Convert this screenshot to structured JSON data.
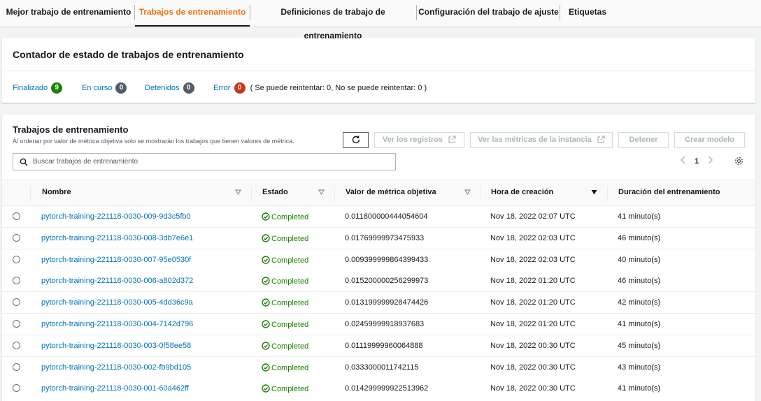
{
  "tabs": [
    {
      "label": "Mejor trabajo de entrenamiento"
    },
    {
      "label": "Trabajos de entrenamiento"
    },
    {
      "label": "Definiciones de trabajo de entrenamiento"
    },
    {
      "label": "Configuración del trabajo de ajuste"
    },
    {
      "label": "Etiquetas"
    }
  ],
  "counter": {
    "title": "Contador de estado de trabajos de entrenamiento",
    "completed_label": "Finalizado",
    "completed_count": "9",
    "inprogress_label": "En curso",
    "inprogress_count": "0",
    "stopped_label": "Detenidos",
    "stopped_count": "0",
    "error_label": "Error",
    "error_count": "0",
    "error_note": "( Se puede reintentar: 0, No se puede reintentar: 0 )"
  },
  "jobs": {
    "title": "Trabajos de entrenamiento",
    "subtitle": "Al ordenar por valor de métrica objetiva solo se mostrarán los trabajos que tienen valores de métrica.",
    "btn_logs": "Ver los registros",
    "btn_metrics": "Ver las métricas de la instancia",
    "btn_stop": "Detener",
    "btn_create": "Crear modelo",
    "search_placeholder": "Buscar trabajos de entrenamiento",
    "page": "1"
  },
  "table": {
    "headers": {
      "name": "Nombre",
      "status": "Estado",
      "metric": "Valor de métrica objetiva",
      "created": "Hora de creación",
      "duration": "Duración del entrenamiento"
    },
    "rows": [
      {
        "name": "pytorch-training-221118-0030-009-9d3c5fb0",
        "status": "Completed",
        "metric": "0.011800000444054604",
        "created": "Nov 18, 2022 02:07 UTC",
        "duration": "41 minuto(s)"
      },
      {
        "name": "pytorch-training-221118-0030-008-3db7e6e1",
        "status": "Completed",
        "metric": "0.01769999973475933",
        "created": "Nov 18, 2022 02:03 UTC",
        "duration": "46 minuto(s)"
      },
      {
        "name": "pytorch-training-221118-0030-007-95e0530f",
        "status": "Completed",
        "metric": "0.009399999864399433",
        "created": "Nov 18, 2022 02:03 UTC",
        "duration": "40 minuto(s)"
      },
      {
        "name": "pytorch-training-221118-0030-006-a802d372",
        "status": "Completed",
        "metric": "0.015200000256299973",
        "created": "Nov 18, 2022 01:20 UTC",
        "duration": "46 minuto(s)"
      },
      {
        "name": "pytorch-training-221118-0030-005-4dd36c9a",
        "status": "Completed",
        "metric": "0.013199999928474426",
        "created": "Nov 18, 2022 01:20 UTC",
        "duration": "42 minuto(s)"
      },
      {
        "name": "pytorch-training-221118-0030-004-7142d796",
        "status": "Completed",
        "metric": "0.02459999918937683",
        "created": "Nov 18, 2022 01:20 UTC",
        "duration": "41 minuto(s)"
      },
      {
        "name": "pytorch-training-221118-0030-003-0f58ee58",
        "status": "Completed",
        "metric": "0.01119999960064888",
        "created": "Nov 18, 2022 00:30 UTC",
        "duration": "45 minuto(s)"
      },
      {
        "name": "pytorch-training-221118-0030-002-fb9bd105",
        "status": "Completed",
        "metric": "0.0333000011742115",
        "created": "Nov 18, 2022 00:30 UTC",
        "duration": "43 minuto(s)"
      },
      {
        "name": "pytorch-training-221118-0030-001-60a462ff",
        "status": "Completed",
        "metric": "0.014299999922513962",
        "created": "Nov 18, 2022 00:30 UTC",
        "duration": "41 minuto(s)"
      }
    ]
  },
  "colors": {
    "accent": "#ec7211",
    "link": "#0073bb",
    "success": "#1d8102",
    "error": "#d13212",
    "neutral_badge": "#545b64"
  }
}
